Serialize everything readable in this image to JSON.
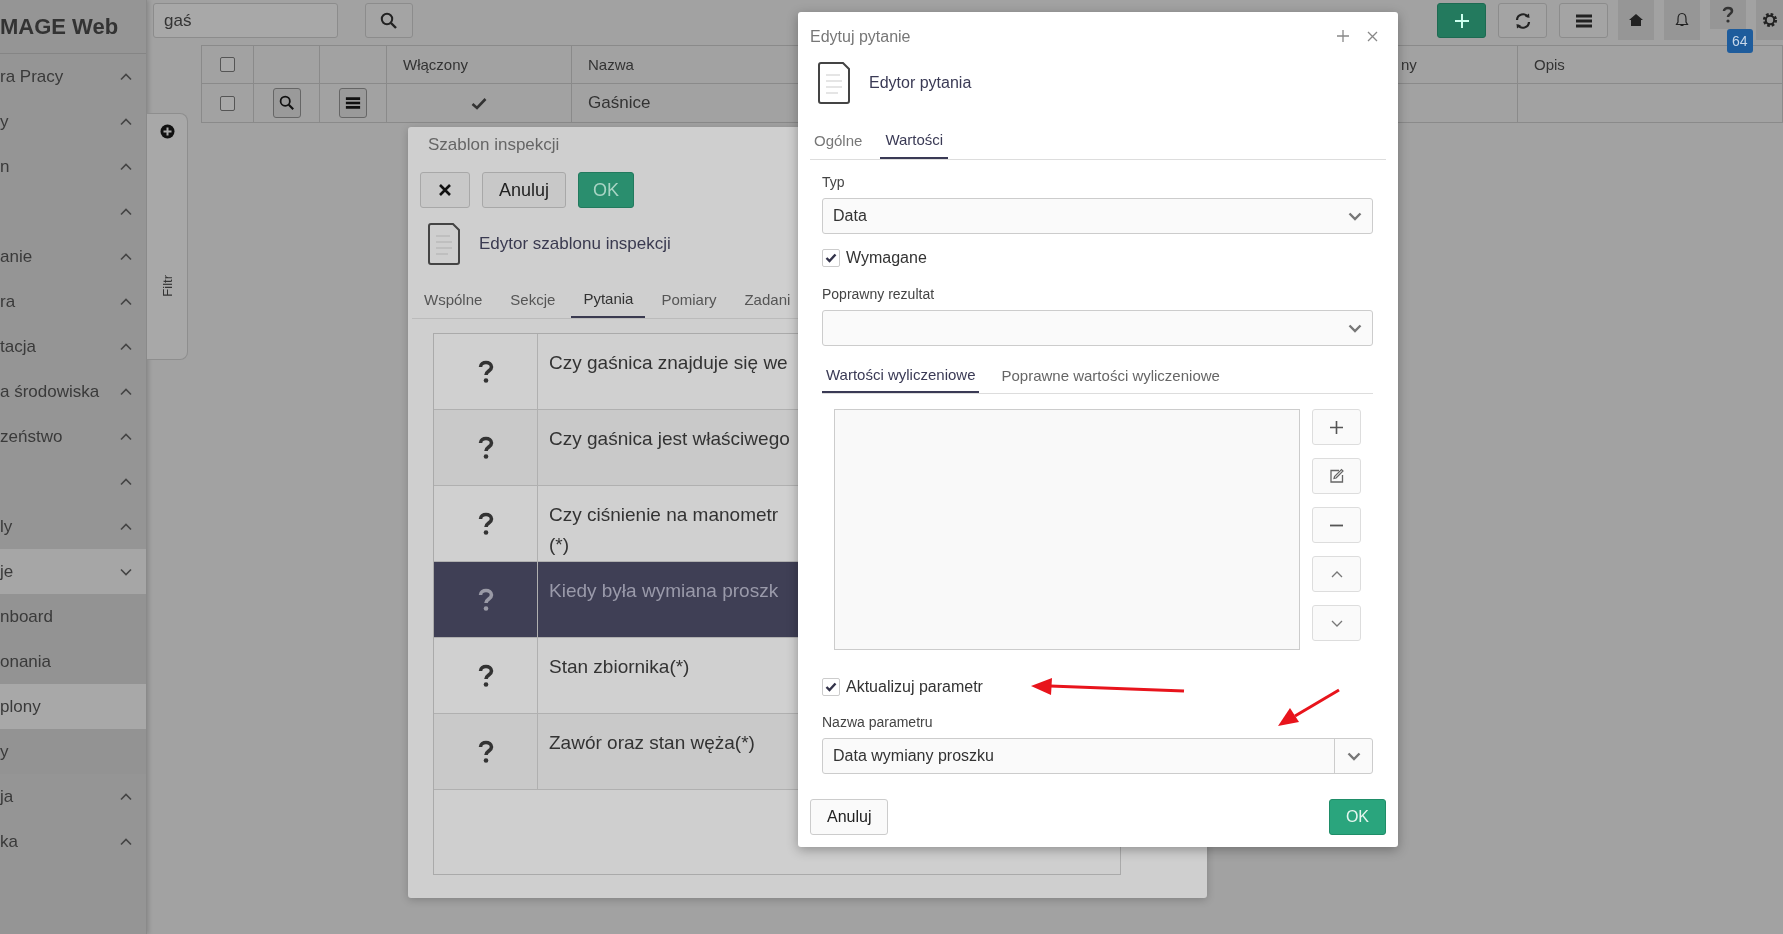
{
  "app": {
    "brand": "MAGE Web"
  },
  "search": {
    "value": "gaś"
  },
  "sidebar": {
    "items": [
      {
        "label": "ra Pracy",
        "expanded": false,
        "selected": false
      },
      {
        "label": "y",
        "expanded": false,
        "selected": false
      },
      {
        "label": "n",
        "expanded": false,
        "selected": false
      },
      {
        "expanded": false,
        "selected": false
      },
      {
        "label": "anie",
        "expanded": false,
        "selected": false
      },
      {
        "label": "ra",
        "expanded": false,
        "selected": false
      },
      {
        "label": "tacja",
        "expanded": false,
        "selected": false
      },
      {
        "label": "a środowiska",
        "expanded": false,
        "selected": false
      },
      {
        "label": "zeństwo",
        "expanded": false,
        "selected": false
      },
      {
        "expanded": false,
        "selected": false
      },
      {
        "label": "ly",
        "expanded": false,
        "selected": false
      },
      {
        "label": "je",
        "expanded": true,
        "selected": true,
        "children": [
          {
            "label": "nboard",
            "selected": false
          },
          {
            "label": "onania",
            "selected": false
          },
          {
            "label": "plony",
            "selected": true
          },
          {
            "label": "y",
            "selected": false
          }
        ]
      },
      {
        "label": "ja",
        "expanded": false,
        "selected": false
      },
      {
        "label": "ka",
        "expanded": false,
        "selected": false
      }
    ]
  },
  "filter_panel": {
    "label": "Filtr"
  },
  "table": {
    "all_checked": false,
    "columns": [
      {
        "label": "Włączony"
      },
      {
        "label": "Nazwa"
      },
      {
        "label": "ny"
      },
      {
        "label": "Opis"
      }
    ],
    "rows": [
      {
        "checked": false,
        "enabled": true,
        "name": "Gaśnice"
      }
    ]
  },
  "toolbar": {
    "badge": "64"
  },
  "template_dialog": {
    "title": "Szablon inspekcji",
    "cancel": "Anuluj",
    "ok": "OK",
    "heading": "Edytor szablonu inspekcji",
    "tabs": [
      {
        "label": "Wspólne",
        "selected": false
      },
      {
        "label": "Sekcje",
        "selected": false
      },
      {
        "label": "Pytania",
        "selected": true
      },
      {
        "label": "Pomiary",
        "selected": false
      },
      {
        "label": "Zadani",
        "selected": false
      }
    ],
    "questions": [
      {
        "text": "Czy gaśnica znajduje się we",
        "selected": false
      },
      {
        "text": "Czy gaśnica jest właściwego",
        "selected": false
      },
      {
        "text": "Czy ciśnienie na manometr",
        "text_2": "(*)",
        "selected": false
      },
      {
        "text": "Kiedy była wymiana proszk",
        "selected": true
      },
      {
        "text": "Stan zbiornika(*)",
        "selected": false
      },
      {
        "text": "Zawór oraz stan węża(*)",
        "selected": false
      }
    ]
  },
  "question_dialog": {
    "title": "Edytuj pytanie",
    "heading": "Edytor pytania",
    "tabs": [
      {
        "label": "Ogólne",
        "selected": false
      },
      {
        "label": "Wartości",
        "selected": true
      }
    ],
    "type_label": "Typ",
    "type_value": "Data",
    "required": {
      "label": "Wymagane",
      "checked": true
    },
    "result_label": "Poprawny rezultat",
    "subtabs": [
      {
        "label": "Wartości wyliczeniowe",
        "selected": true
      },
      {
        "label": "Poprawne wartości wyliczeniowe",
        "selected": false
      }
    ],
    "update_param": {
      "label": "Aktualizuj parametr",
      "checked": true
    },
    "param_label": "Nazwa parametru",
    "param_value": "Data wymiany proszku",
    "cancel": "Anuluj",
    "ok": "OK"
  }
}
